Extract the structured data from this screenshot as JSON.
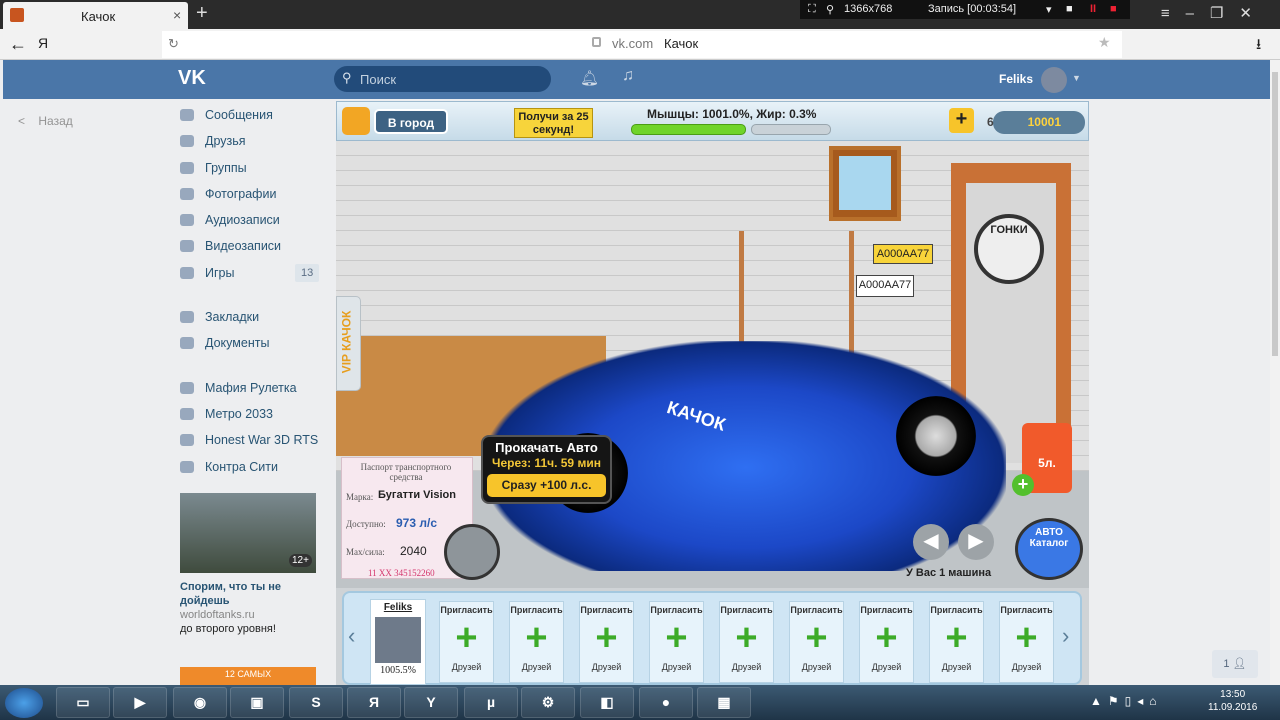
{
  "browser": {
    "tab_title": "Качок",
    "new_tab": "+",
    "close_tab": "×",
    "yandex_glyph": "Я",
    "domain": "vk.com",
    "page_title": "Качок",
    "recording": {
      "resolution": "1366x768",
      "label": "Запись [00:03:54]"
    }
  },
  "vk": {
    "logo": "VK",
    "search_placeholder": "Поиск",
    "user_name": "Feliks",
    "back_label": "Назад",
    "menu": [
      {
        "label": "Сообщения",
        "icon": "messages-icon"
      },
      {
        "label": "Друзья",
        "icon": "friends-icon"
      },
      {
        "label": "Группы",
        "icon": "groups-icon"
      },
      {
        "label": "Фотографии",
        "icon": "camera-icon"
      },
      {
        "label": "Аудиозаписи",
        "icon": "music-icon"
      },
      {
        "label": "Видеозаписи",
        "icon": "video-icon"
      },
      {
        "label": "Игры",
        "icon": "gamepad-icon",
        "count": "13"
      },
      {
        "label": "",
        "icon": ""
      },
      {
        "label": "Закладки",
        "icon": "star-icon"
      },
      {
        "label": "Документы",
        "icon": "document-icon"
      },
      {
        "label": "",
        "icon": ""
      },
      {
        "label": "Мафия Рулетка",
        "icon": "app-icon"
      },
      {
        "label": "Метро 2033",
        "icon": "app-icon"
      },
      {
        "label": "Honest War 3D RTS",
        "icon": "app-icon"
      },
      {
        "label": "Контра Сити",
        "icon": "app-icon"
      }
    ],
    "ad": {
      "age": "12+",
      "title": "Спорим, что ты не дойдешь",
      "site": "worldoftanks.ru",
      "desc": "до второго уровня!"
    },
    "ad2_label": "12 САМЫХ",
    "chat_count": "1"
  },
  "game": {
    "city_button": "В город",
    "promo": "Получи за 25 секунд!",
    "stats": "Мышцы: 1001.0%, Жир: 0.3%",
    "gems": "6",
    "coins": "10001",
    "vip": "VIP КАЧОК",
    "races": "ГОНКИ",
    "plate": "A000AA77",
    "fuel": "5л.",
    "car_logo": "КАЧОК",
    "car_count": "У Вас 1 машина",
    "catalog": "АВТО Каталог",
    "passport": {
      "header": "Паспорт транспортного средства",
      "brand_label": "Марка:",
      "brand": "Бугатти Vision",
      "access_label": "Доступно:",
      "access": "973 л/с",
      "max_label": "Max/сила:",
      "max": "2040",
      "serial": "11 XX 345152260"
    },
    "upgrade": {
      "title": "Прокачать Авто",
      "timer": "Через: 11ч. 59 мин",
      "button": "Сразу +100 л.с."
    },
    "friends": {
      "me_name": "Feliks",
      "me_percent": "1005.5%",
      "invite": "Пригласить",
      "friend_label": "Друзей",
      "plus": "+"
    }
  },
  "taskbar": {
    "time": "13:50",
    "date": "11.09.2016",
    "yandex": "Я"
  }
}
